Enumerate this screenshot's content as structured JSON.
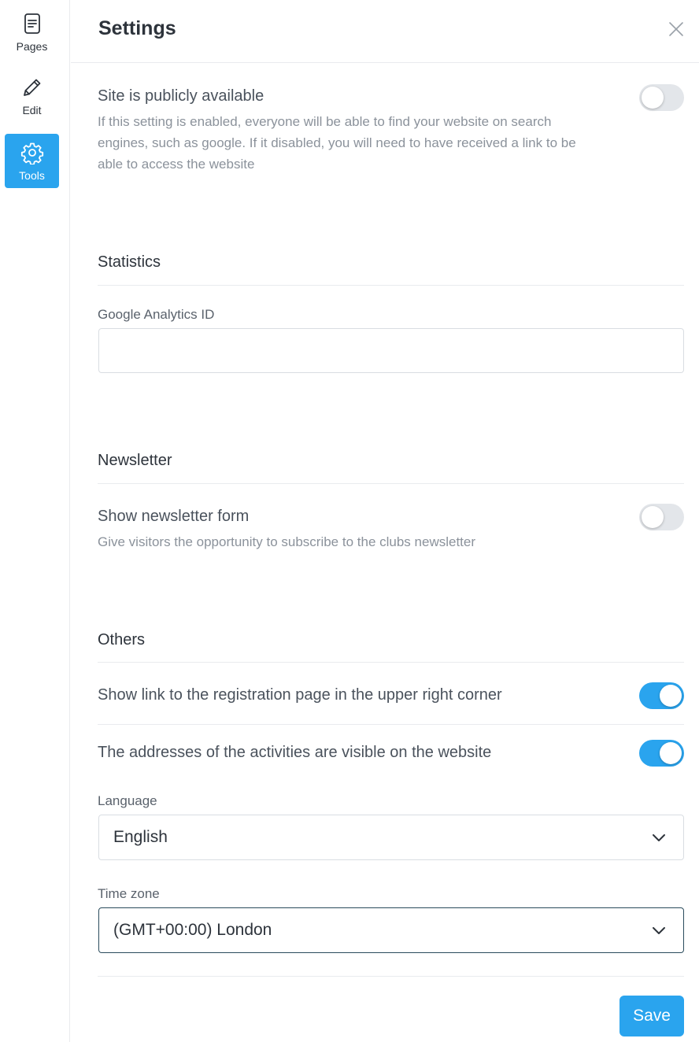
{
  "sidebar": {
    "items": [
      {
        "label": "Pages",
        "icon": "document-icon",
        "active": false
      },
      {
        "label": "Edit",
        "icon": "pencil-icon",
        "active": false
      },
      {
        "label": "Tools",
        "icon": "gear-icon",
        "active": true
      }
    ]
  },
  "header": {
    "title": "Settings",
    "close_icon": "close-icon"
  },
  "public_setting": {
    "title": "Site is publicly available",
    "description_lines": [
      "If this setting is enabled, everyone will be able to find your website on search",
      "engines, such as google. If it disabled, you will need to have received a link to be",
      "able to access the website"
    ],
    "enabled": false
  },
  "statistics": {
    "section_title": "Statistics",
    "ga_label": "Google Analytics ID",
    "ga_value": "",
    "ga_placeholder": ""
  },
  "newsletter": {
    "section_title": "Newsletter",
    "title": "Show newsletter form",
    "description": "Give visitors the opportunity to subscribe to the clubs newsletter",
    "enabled": false
  },
  "others": {
    "section_title": "Others",
    "registration_link": {
      "title": "Show link to the registration page in the upper right corner",
      "enabled": true
    },
    "addresses_visible": {
      "title": "The addresses of the activities are visible on the website",
      "enabled": true
    },
    "language": {
      "label": "Language",
      "value": "English"
    },
    "timezone": {
      "label": "Time zone",
      "value": "(GMT+00:00) London"
    }
  },
  "footer": {
    "save_label": "Save"
  },
  "colors": {
    "accent": "#2aa4ee",
    "toggle_off": "#e3e6ea",
    "border": "#e9ebee"
  }
}
